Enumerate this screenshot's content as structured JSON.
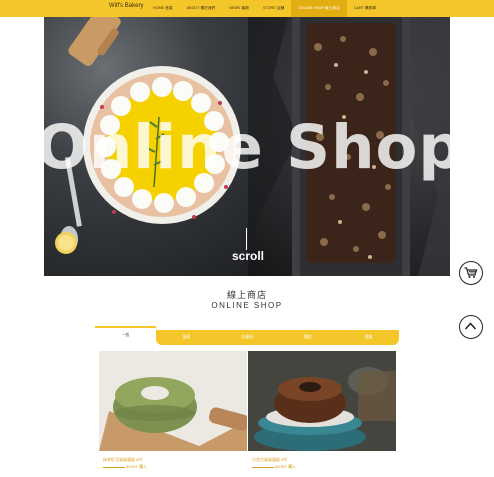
{
  "nav": {
    "brand": "Wilf's Bakery",
    "items": [
      {
        "label": "HOME 首頁",
        "active": false
      },
      {
        "label": "ABOUT 關於我們",
        "active": false
      },
      {
        "label": "NEWS 最新",
        "active": false
      },
      {
        "label": "STORE 店舖",
        "active": false
      },
      {
        "label": "ONLINE SHOP 線上商店",
        "active": true
      },
      {
        "label": "CART 購物車",
        "active": false
      }
    ],
    "color": "#f4c62a"
  },
  "hero": {
    "title": "Online Shop O",
    "scroll_label": "scroll"
  },
  "section": {
    "title_zh": "線上商店",
    "title_en": "ONLINE SHOP"
  },
  "tabs": {
    "active": "一般",
    "items": [
      "蛋糕",
      "計量冊",
      "麵包",
      "禮盒"
    ]
  },
  "products": [
    {
      "name": "抹茶紅豆戚風蛋糕 6吋",
      "price_unit": "500NT",
      "buy": "購入"
    },
    {
      "name": "巧克力戚風蛋糕 6吋",
      "price_unit": "500NT",
      "buy": "購入"
    }
  ],
  "icons": {
    "cart": "cart-icon",
    "back_to_top": "chevron-up-icon"
  }
}
